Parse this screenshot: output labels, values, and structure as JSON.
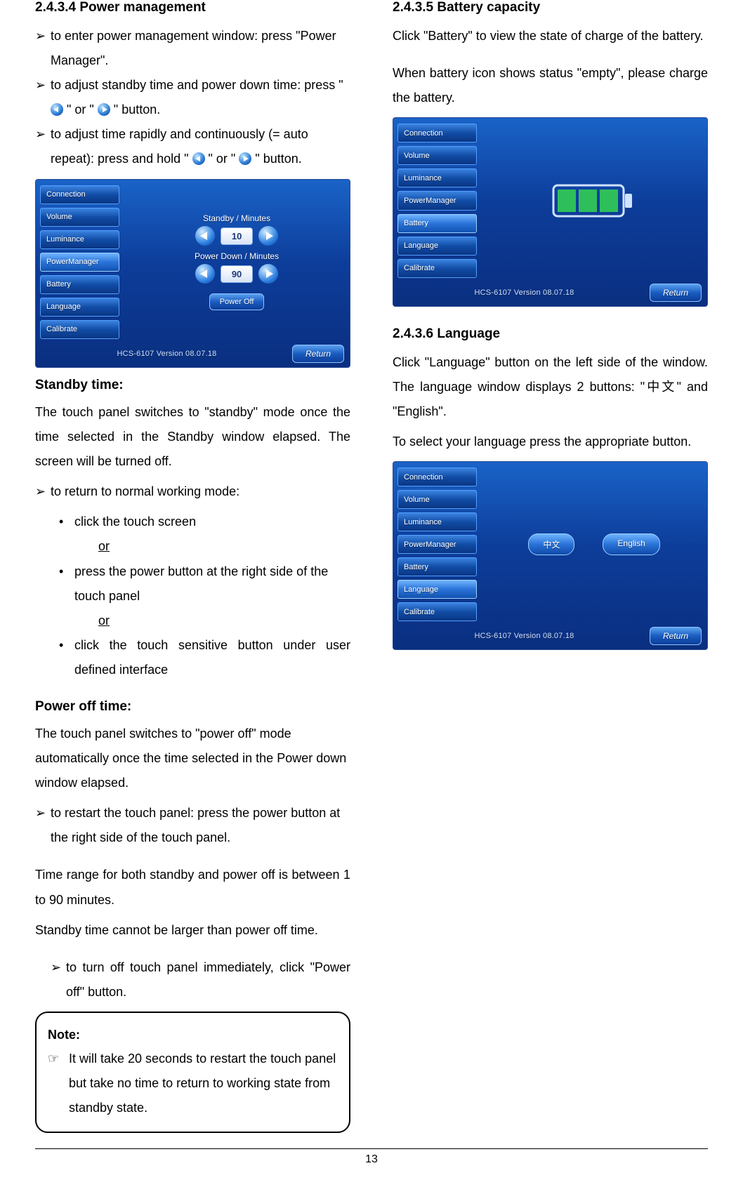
{
  "left": {
    "heading": "2.4.3.4 Power management",
    "b1": "to enter power management window: press \"Power Manager\".",
    "b2a": "to adjust standby time and power down time: press \" ",
    "b2b": " \" or \" ",
    "b2c": " \" button.",
    "b3a": "to adjust time rapidly and continuously (= auto repeat): press and hold \" ",
    "b3b": " \" or \" ",
    "b3c": " \" button.",
    "standby_title": "Standby time:",
    "standby_para": "The touch panel switches to \"standby\" mode once the time selected in the Standby window elapsed. The screen will be turned off.",
    "b4": "to return to normal working mode:",
    "s1": "click the touch screen",
    "or": "or",
    "s2": "press the power button at the right side of the touch panel",
    "s3": "click the touch sensitive button under user defined interface",
    "poweroff_title": "Power off time:",
    "poweroff_para": "The touch panel switches to \"power off\" mode automatically once the time selected in the Power down window elapsed.",
    "b5": "to restart the touch panel: press the power button at the right side of the touch panel.",
    "range": "Time range for both standby and power off is between 1 to 90 minutes.",
    "rule": "Standby time cannot be larger than power off time.",
    "b6": "to turn off touch panel immediately, click \"Power off\" button.",
    "note_title": "Note:",
    "note_body": "It will take 20 seconds to restart the touch panel but take no time to return to working state from standby state."
  },
  "right": {
    "h_batt": "2.4.3.5 Battery capacity",
    "batt_p1": "Click \"Battery\" to view the state of charge of the battery.",
    "batt_p2": "When battery icon shows status \"empty\", please charge the battery.",
    "h_lang": "2.4.3.6 Language",
    "lang_p1": "Click \"Language\" button on the left side of the window. The language window displays 2 buttons: \"中文\" and \"English\".",
    "lang_p2": "To select your language press the appropriate button."
  },
  "device": {
    "tabs": [
      "Connection",
      "Volume",
      "Luminance",
      "PowerManager",
      "Battery",
      "Language",
      "Calibrate"
    ],
    "standby_label": "Standby / Minutes",
    "standby_value": "10",
    "powerdown_label": "Power Down / Minutes",
    "powerdown_value": "90",
    "poweroff_btn": "Power Off",
    "version": "HCS-6107 Version 08.07.18",
    "return": "Return",
    "lang_cn": "中文",
    "lang_en": "English"
  },
  "markers": {
    "tri": "➢",
    "dot": "•",
    "hand": "☞"
  },
  "page_number": "13"
}
